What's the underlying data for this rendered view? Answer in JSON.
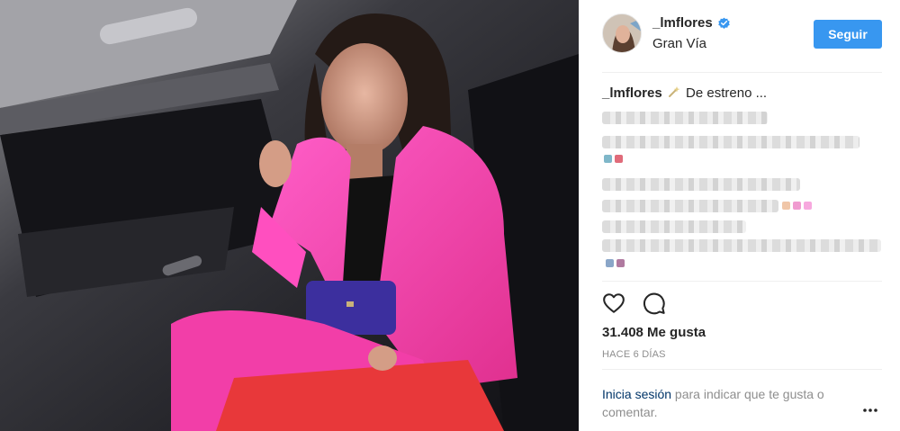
{
  "post": {
    "username": "_lmflores",
    "location": "Gran Vía",
    "follow_label": "Seguir",
    "caption_user": "_lmflores",
    "caption_text": "De estreno ...",
    "likes": "31.408 Me gusta",
    "timestamp": "HACE 6 DÍAS",
    "login_link": "Inicia sesión",
    "login_rest": " para indicar que te gusta o comentar."
  },
  "icons": {
    "verified": "verified-badge-icon",
    "caption_emoji": "sparkle-emoji-icon",
    "like": "heart-icon",
    "comment": "comment-bubble-icon",
    "more": "more-options-icon"
  },
  "colors": {
    "follow_button": "#3897f0",
    "verified": "#3897f0",
    "link": "#003569",
    "muted": "#8e8e8e"
  }
}
